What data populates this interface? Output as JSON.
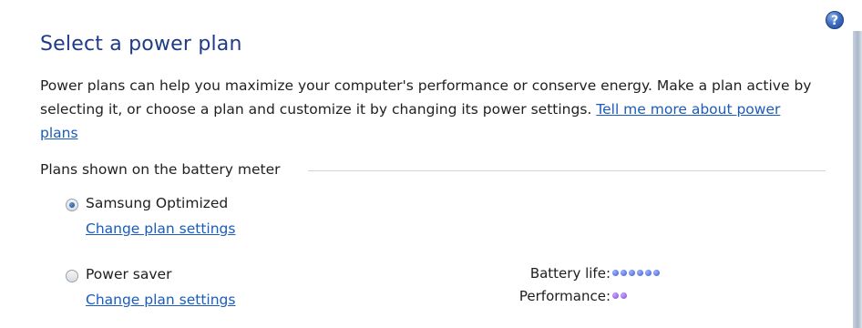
{
  "help": {
    "label": "?"
  },
  "title": "Select a power plan",
  "description": {
    "text": "Power plans can help you maximize your computer's performance or conserve energy. Make a plan active by selecting it, or choose a plan and customize it by changing its power settings. ",
    "link": "Tell me more about power plans"
  },
  "group": {
    "title": "Plans shown on the battery meter"
  },
  "plans": [
    {
      "name": "Samsung Optimized",
      "link": "Change plan settings",
      "selected": true
    },
    {
      "name": "Power saver",
      "link": "Change plan settings",
      "selected": false
    }
  ],
  "meters": {
    "battery_label": "Battery life:",
    "battery_dots": 6,
    "performance_label": "Performance:",
    "performance_dots": 2
  },
  "colors": {
    "title": "#1e3b8a",
    "link": "#1a5bbf",
    "battery_dot": "#3a58d8",
    "performance_dot": "#7d49d8"
  }
}
